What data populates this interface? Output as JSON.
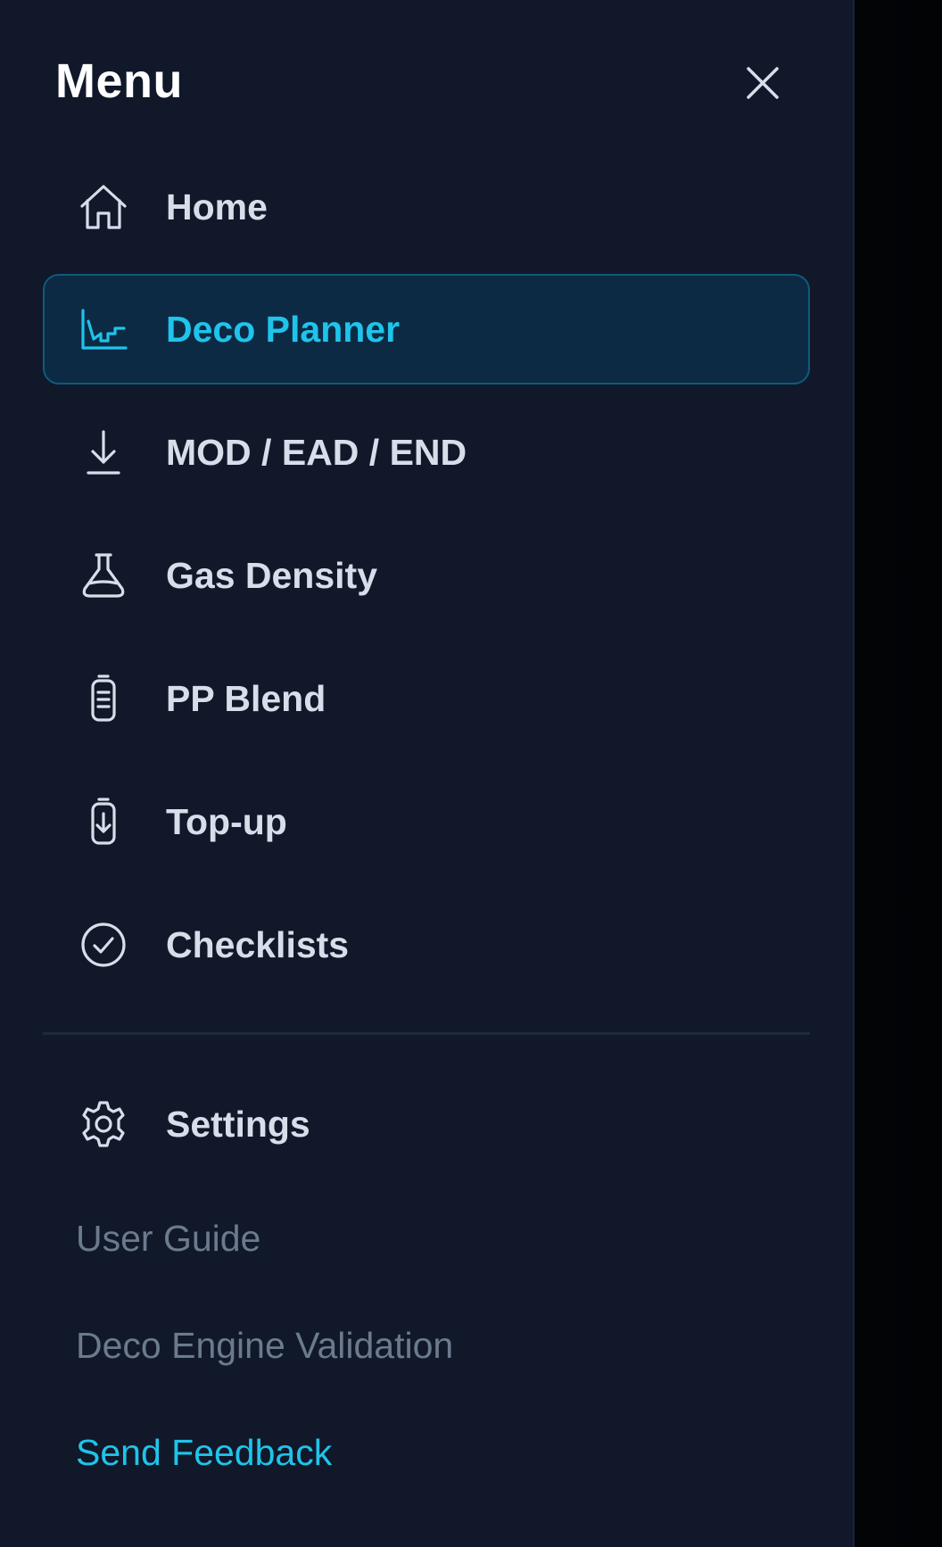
{
  "menu": {
    "title": "Menu",
    "close_icon": "close-icon"
  },
  "nav": {
    "items": [
      {
        "label": "Home",
        "icon": "home-icon",
        "active": false
      },
      {
        "label": "Deco Planner",
        "icon": "chart-steps-icon",
        "active": true
      },
      {
        "label": "MOD / EAD / END",
        "icon": "download-arrow-icon",
        "active": false
      },
      {
        "label": "Gas Density",
        "icon": "flask-icon",
        "active": false
      },
      {
        "label": "PP Blend",
        "icon": "cylinder-icon",
        "active": false
      },
      {
        "label": "Top-up",
        "icon": "cylinder-arrow-icon",
        "active": false
      },
      {
        "label": "Checklists",
        "icon": "check-circle-icon",
        "active": false
      }
    ],
    "settings": {
      "label": "Settings",
      "icon": "gear-icon"
    }
  },
  "links": {
    "user_guide": "User Guide",
    "deco_engine_validation": "Deco Engine Validation",
    "send_feedback": "Send Feedback"
  },
  "colors": {
    "drawer_bg": "#101829",
    "accent": "#1fc4ea",
    "text": "#d7deea",
    "muted": "#6c7a8e",
    "active_bg": "#0d2a45"
  }
}
